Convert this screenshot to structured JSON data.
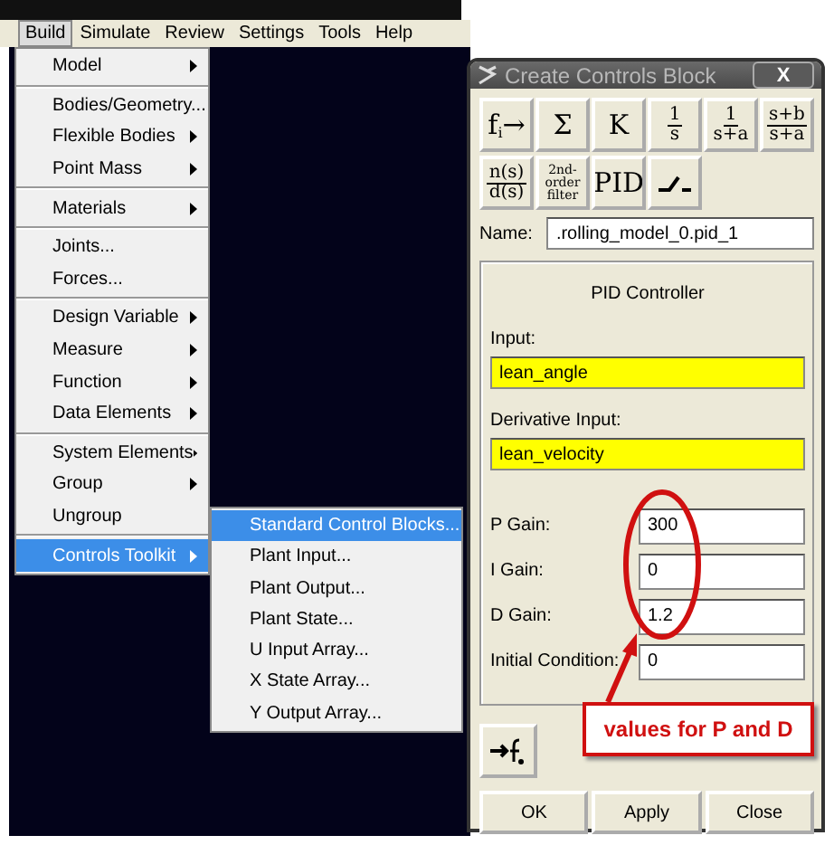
{
  "menubar": [
    {
      "label": "Build",
      "selected": true
    },
    {
      "label": "Simulate",
      "selected": false
    },
    {
      "label": "Review",
      "selected": false
    },
    {
      "label": "Settings",
      "selected": false
    },
    {
      "label": "Tools",
      "selected": false
    },
    {
      "label": "Help",
      "selected": false
    }
  ],
  "build_menu": {
    "groups": [
      [
        {
          "label": "Model",
          "has_submenu": true,
          "selected": false
        }
      ],
      [
        {
          "label": "Bodies/Geometry...",
          "has_submenu": false,
          "selected": false
        },
        {
          "label": "Flexible Bodies",
          "has_submenu": true,
          "selected": false
        },
        {
          "label": "Point Mass",
          "has_submenu": true,
          "selected": false
        }
      ],
      [
        {
          "label": "Materials",
          "has_submenu": true,
          "selected": false
        }
      ],
      [
        {
          "label": "Joints...",
          "has_submenu": false,
          "selected": false
        },
        {
          "label": "Forces...",
          "has_submenu": false,
          "selected": false
        }
      ],
      [
        {
          "label": "Design Variable",
          "has_submenu": true,
          "selected": false
        },
        {
          "label": "Measure",
          "has_submenu": true,
          "selected": false
        },
        {
          "label": "Function",
          "has_submenu": true,
          "selected": false
        },
        {
          "label": "Data Elements",
          "has_submenu": true,
          "selected": false
        }
      ],
      [
        {
          "label": "System Elements",
          "has_submenu": true,
          "selected": false
        },
        {
          "label": "Group",
          "has_submenu": true,
          "selected": false
        },
        {
          "label": "Ungroup",
          "has_submenu": false,
          "selected": false
        }
      ],
      [
        {
          "label": "Controls Toolkit",
          "has_submenu": true,
          "selected": true
        }
      ]
    ]
  },
  "submenu": [
    {
      "label": "Standard Control Blocks...",
      "selected": true
    },
    {
      "label": "Plant Input...",
      "selected": false
    },
    {
      "label": "Plant Output...",
      "selected": false
    },
    {
      "label": "Plant State...",
      "selected": false
    },
    {
      "label": "U Input Array...",
      "selected": false
    },
    {
      "label": "X State Array...",
      "selected": false
    },
    {
      "label": "Y Output Array...",
      "selected": false
    }
  ],
  "dialog": {
    "title": "Create Controls Block",
    "close": "X",
    "block_rows": [
      [
        {
          "kind": "text",
          "text": "f$_{i}$→"
        },
        {
          "kind": "text",
          "text": "Σ"
        },
        {
          "kind": "text",
          "text": "K"
        },
        {
          "kind": "fraction",
          "num": "1",
          "den": "s"
        },
        {
          "kind": "fraction",
          "num": "1",
          "den": "s+a"
        },
        {
          "kind": "fraction",
          "num": "s+b",
          "den": "s+a"
        }
      ],
      [
        {
          "kind": "fraction",
          "num": "n(s)",
          "den": "d(s)"
        },
        {
          "kind": "small",
          "text": "2nd-order filter"
        },
        {
          "kind": "text",
          "text": "PID"
        },
        {
          "kind": "switch"
        }
      ]
    ],
    "name_label": "Name:",
    "name_value": ".rolling_model_0.pid_1",
    "panel_title": "PID Controller",
    "input_label": "Input:",
    "input_value": "lean_angle",
    "derivative_label": "Derivative Input:",
    "derivative_value": "lean_velocity",
    "gains": [
      {
        "label": "P Gain:",
        "value": "300"
      },
      {
        "label": "I Gain:",
        "value": "0"
      },
      {
        "label": "D Gain:",
        "value": "1.2"
      },
      {
        "label": "Initial Condition:",
        "value": "0"
      }
    ],
    "buttons": [
      "OK",
      "Apply",
      "Close"
    ]
  },
  "callout": "values for P and D"
}
